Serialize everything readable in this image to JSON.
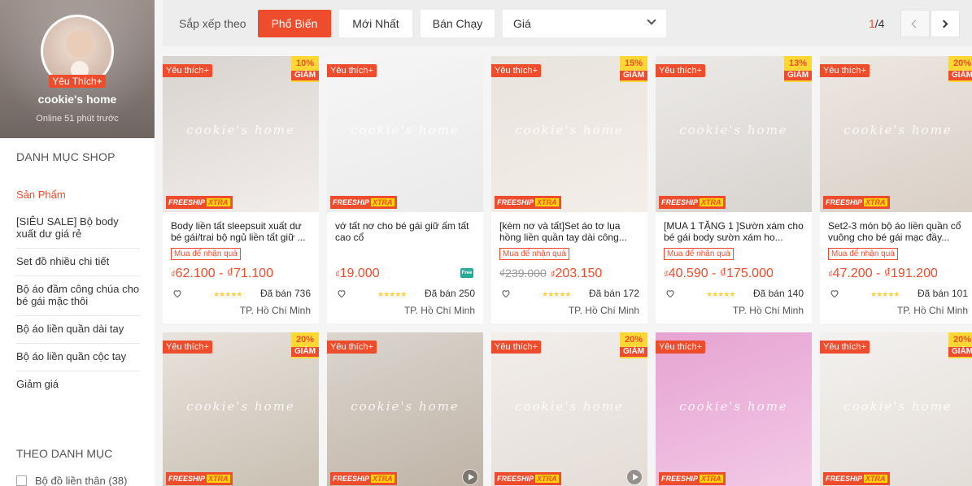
{
  "shop": {
    "badge": "Yêu Thích+",
    "name": "cookie's home",
    "online": "Online 51 phút trước"
  },
  "categories": {
    "title": "DANH MỤC SHOP",
    "items": [
      "Sản Phẩm",
      "[SIÊU SALE] Bộ body xuất dư giá rẻ",
      "Set đồ nhiều chi tiết",
      "Bộ áo đầm công chúa cho bé gái mặc thôi",
      "Bộ áo liền quần dài tay",
      "Bộ áo liền quần cộc tay",
      "Giảm giá"
    ]
  },
  "filter": {
    "title": "THEO DANH MỤC",
    "first_option": "Bộ đồ liền thân (38)"
  },
  "sortbar": {
    "label": "Sắp xếp theo",
    "popular": "Phổ Biến",
    "newest": "Mới Nhất",
    "best_selling": "Bán Chạy",
    "price": "Giá",
    "page_current": "1",
    "page_total": "/4"
  },
  "common": {
    "fav_tag": "Yêu thích+",
    "freeship": "FREESHIP",
    "xtra": "XTRA",
    "gift_tag": "Mua để nhận quà",
    "discount_word": "GIẢM",
    "currency": "₫",
    "stars": "★★★★★",
    "watermark": "cookie's home",
    "free_label": "Free"
  },
  "products": [
    {
      "name": "Body liền tất sleepsuit xuất dư bé gái/trai bộ ngủ liền tất giữ ...",
      "discount": "10%",
      "gift": true,
      "old_price": "",
      "price": "62.100 - ₫71.100",
      "sold": "Đã bán 736",
      "location": "TP. Hồ Chí Minh",
      "colors": [
        "#d9d3cf",
        "#f2eeec"
      ]
    },
    {
      "name": "vớ tất nơ cho bé gái giữ ấm tất cao cổ",
      "discount": "",
      "gift": false,
      "old_price": "",
      "price": "19.000",
      "sold": "Đã bán 250",
      "location": "TP. Hồ Chí Minh",
      "colors": [
        "#f6f6f6",
        "#eaeaea"
      ]
    },
    {
      "name": "[kèm nơ và tất]Set áo tơ lụa hồng liền quần tay dài công...",
      "discount": "15%",
      "gift": true,
      "old_price": "₫239.000",
      "price": "203.150",
      "sold": "Đã bán 172",
      "location": "TP. Hồ Chí Minh",
      "colors": [
        "#e9e3dd",
        "#f4eee9"
      ]
    },
    {
      "name": "[MUA 1 TẶNG 1 ]Sườn xám cho bé gái body sườn xám ho...",
      "discount": "13%",
      "gift": true,
      "old_price": "",
      "price": "40.590 - ₫175.000",
      "sold": "Đã bán 140",
      "location": "TP. Hồ Chí Minh",
      "colors": [
        "#eceae8",
        "#d7d3cf"
      ]
    },
    {
      "name": "Set2-3 món bộ áo liền quần cổ vuông cho bé gái mạc đầy...",
      "discount": "20%",
      "gift": true,
      "old_price": "",
      "price": "47.200 - ₫191.200",
      "sold": "Đã bán 101",
      "location": "TP. Hồ Chí Minh",
      "colors": [
        "#ede8e2",
        "#d9cfc6"
      ]
    },
    {
      "name": "",
      "discount": "20%",
      "gift": false,
      "old_price": "",
      "price": "",
      "sold": "",
      "location": "",
      "colors": [
        "#e8e3dc",
        "#c9bfb2"
      ]
    },
    {
      "name": "",
      "discount": "",
      "gift": false,
      "old_price": "",
      "price": "",
      "sold": "",
      "location": "",
      "colors": [
        "#dcd6cf",
        "#bfb3a6"
      ]
    },
    {
      "name": "",
      "discount": "20%",
      "gift": false,
      "old_price": "",
      "price": "",
      "sold": "",
      "location": "",
      "colors": [
        "#f2eeeb",
        "#e4ddd7"
      ]
    },
    {
      "name": "",
      "discount": "",
      "gift": false,
      "old_price": "",
      "price": "",
      "sold": "",
      "location": "",
      "colors": [
        "#e6a3d2",
        "#f3c9e6"
      ]
    },
    {
      "name": "",
      "discount": "20%",
      "gift": false,
      "old_price": "",
      "price": "",
      "sold": "",
      "location": "",
      "colors": [
        "#f3f1ef",
        "#e3ddd7"
      ]
    }
  ],
  "colors": {
    "accent": "#ee4d2d",
    "discount_bg": "#fdd835",
    "star": "#ffce3d"
  }
}
